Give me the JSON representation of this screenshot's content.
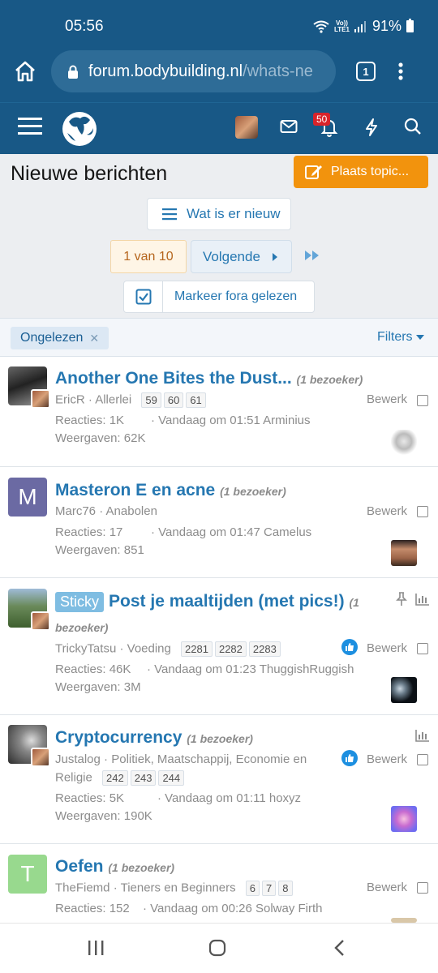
{
  "status": {
    "time": "05:56",
    "volte_top": "Vo))",
    "volte_bottom": "LTE1",
    "battery": "91%"
  },
  "browser": {
    "url_domain": "forum.bodybuilding.nl",
    "url_path": "/whats-ne",
    "tab_count": "1"
  },
  "header": {
    "notification_count": "50"
  },
  "page": {
    "title": "Nieuwe berichten",
    "post_button": "Plaats topic...",
    "whats_new": "Wat is er nieuw",
    "pagination": {
      "current": "1 van 10",
      "next": "Volgende"
    },
    "mark_read": "Markeer fora gelezen",
    "filter_chip": "Ongelezen",
    "filters": "Filters"
  },
  "threads": [
    {
      "title": "Another One Bites the Dust...",
      "visitors": "(1 bezoeker)",
      "author": "EricR",
      "forum": "Allerlei",
      "pages": [
        "59",
        "60",
        "61"
      ],
      "replies": "Reacties: 1K",
      "views": "Weergaven: 62K",
      "last": "· Vandaag om 01:51 Arminius",
      "edit": "Bewerk"
    },
    {
      "title": "Masteron E en acne",
      "visitors": "(1 bezoeker)",
      "avatar_letter": "M",
      "author": "Marc76",
      "forum": "Anabolen",
      "replies": "Reacties: 17",
      "views": "Weergaven: 851",
      "last": "· Vandaag om 01:47 Camelus",
      "edit": "Bewerk"
    },
    {
      "sticky": "Sticky",
      "title": "Post je maaltijden (met pics!)",
      "visitors_a": "(1",
      "visitors_b": "bezoeker)",
      "author": "TrickyTatsu",
      "forum": "Voeding",
      "pages": [
        "2281",
        "2282",
        "2283"
      ],
      "replies": "Reacties: 46K",
      "views": "Weergaven: 3M",
      "last": "· Vandaag om 01:23 ThuggishRuggish",
      "edit": "Bewerk"
    },
    {
      "title": "Cryptocurrency",
      "visitors": "(1 bezoeker)",
      "author": "Justalog",
      "forum_a": "Politiek, Maatschappij, Economie en",
      "forum_b": "Religie",
      "pages": [
        "242",
        "243",
        "244"
      ],
      "replies": "Reacties: 5K",
      "views": "Weergaven: 190K",
      "last": "· Vandaag om 01:11 hoxyz",
      "edit": "Bewerk"
    },
    {
      "title": "Oefen",
      "visitors": "(1 bezoeker)",
      "avatar_letter": "T",
      "author": "TheFiemd",
      "forum": "Tieners en Beginners",
      "pages": [
        "6",
        "7",
        "8"
      ],
      "replies": "Reacties: 152",
      "last": "· Vandaag om 00:26 Solway Firth",
      "edit": "Bewerk"
    }
  ],
  "colors": {
    "brand": "#185886",
    "link": "#2577b1",
    "accent": "#f2930d"
  }
}
